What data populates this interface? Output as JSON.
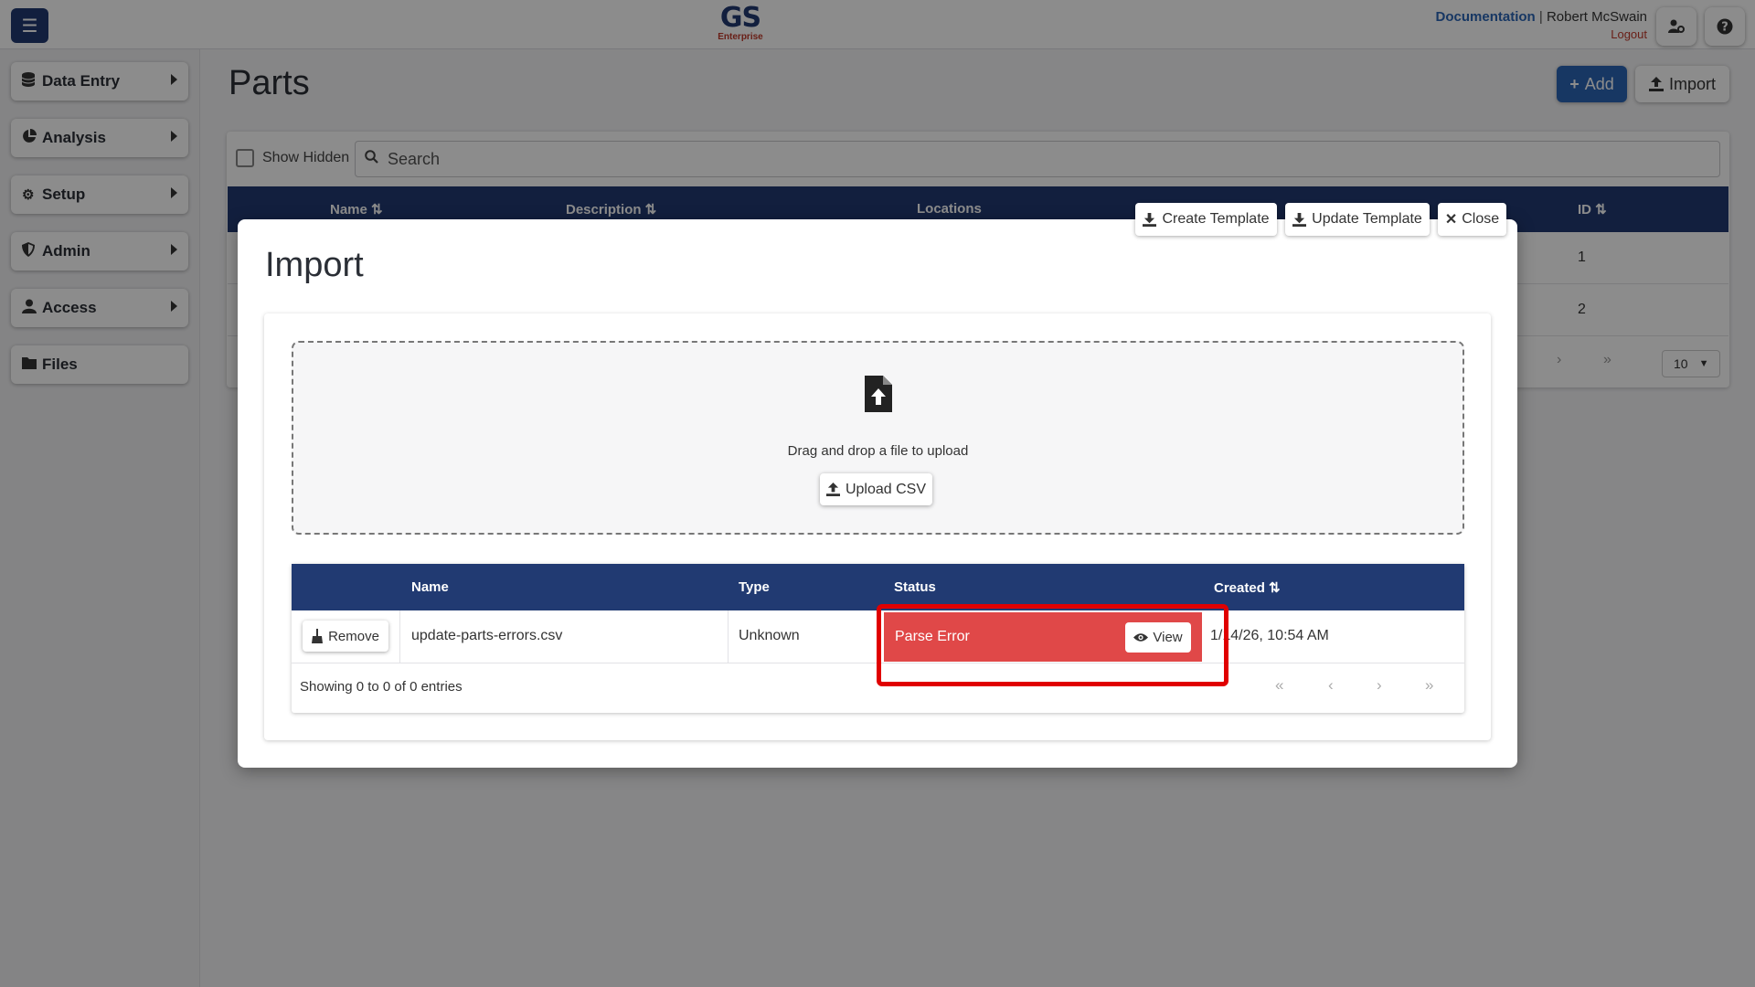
{
  "app": {
    "logo_main": "GS",
    "logo_sub": "Enterprise",
    "documentation_label": "Documentation",
    "separator": "|",
    "user_name": "Robert McSwain",
    "logout_label": "Logout"
  },
  "sidebar": {
    "items": [
      {
        "label": "Data Entry",
        "icon": "database-icon",
        "has_arrow": true
      },
      {
        "label": "Analysis",
        "icon": "pie-chart-icon",
        "has_arrow": true
      },
      {
        "label": "Setup",
        "icon": "gear-icon",
        "has_arrow": true
      },
      {
        "label": "Admin",
        "icon": "shield-icon",
        "has_arrow": true
      },
      {
        "label": "Access",
        "icon": "user-icon",
        "has_arrow": true
      },
      {
        "label": "Files",
        "icon": "folder-icon",
        "has_arrow": false
      }
    ]
  },
  "page": {
    "title": "Parts",
    "add_label": "Add",
    "import_label": "Import",
    "show_hidden_label": "Show Hidden",
    "search_placeholder": "Search",
    "columns": [
      "Name",
      "Description",
      "Locations",
      "ID"
    ],
    "rows": [
      {
        "id": "1"
      },
      {
        "id": "2"
      }
    ],
    "page_size": "10"
  },
  "modal": {
    "title": "Import",
    "create_template_label": "Create Template",
    "update_template_label": "Update Template",
    "close_label": "Close",
    "drop_text": "Drag and drop a file to upload",
    "upload_label": "Upload CSV",
    "table": {
      "columns": [
        "Name",
        "Type",
        "Status",
        "Created"
      ],
      "row": {
        "remove_label": "Remove",
        "name": "update-parts-errors.csv",
        "type": "Unknown",
        "status": "Parse Error",
        "view_label": "View",
        "created": "1/14/26, 10:54 AM"
      },
      "showing": "Showing 0 to 0 of 0 entries"
    }
  },
  "colors": {
    "primary": "#213a72",
    "accent": "#2a64b5",
    "error": "#e04848",
    "highlight": "#e00000",
    "logout": "#c0392b"
  }
}
